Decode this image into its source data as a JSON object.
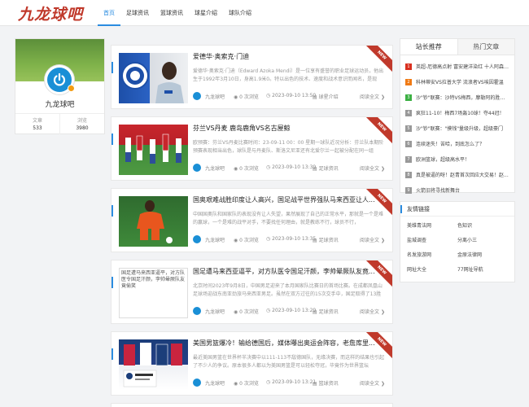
{
  "site": {
    "logo_text": "九龙球吧"
  },
  "nav": [
    "首页",
    "足球资讯",
    "篮球资讯",
    "球星介绍",
    "球队介绍"
  ],
  "profile": {
    "name": "九龙球吧",
    "articles_label": "文章",
    "articles_count": "533",
    "views_label": "浏览",
    "views_count": "3980"
  },
  "articles": [
    {
      "title": "爱德华·奥索克·门迪",
      "excerpt": "爱德华·奥索克·门迪（Edward Azoka Mendi）是一位享有盛誉的职业足球运动员，他出生于1992年3月10日，身高1.9米0。特以出色的技术、速度和战术意识而闻名，是现",
      "author": "九龙球吧",
      "views": "0 次浏览",
      "date": "2023-09-10 13:50",
      "category": "球星介绍",
      "more": "阅读全文",
      "ribbon": "NEW"
    },
    {
      "title": "芬兰VS丹麦 鹿岛鹿角VS名古屋鲸",
      "excerpt": "欧预赛：芬兰VS丹麦比赛时间：23-09-11 00：00 星期一球队近况分析：芬兰队本期阶预赛表现相当出色，球队是与丹麦队、斯洛文尼亚还有北爱尔兰一起被分配在同一组",
      "author": "九龙球吧",
      "views": "0 次浏览",
      "date": "2023-09-10 13:39",
      "category": "足球资讯",
      "more": "阅读全文",
      "ribbon": "NEW"
    },
    {
      "title": "国奥艰难战胜印度让人高兴，国足战平世界强队马来西亚让人...",
      "excerpt": "中国国奥队和国家队的表现没有让人失望，果然展现了自己的正常水平，那就是一个是难的赢球，一个是难的战平对手，不要找任何理由，就是教练不行，球员不行，",
      "author": "九龙球吧",
      "views": "0 次浏览",
      "date": "2023-09-10 13:35",
      "category": "足球资讯",
      "more": "阅读全文",
      "ribbon": "NEW"
    },
    {
      "title": "国足遭马来西亚逼平，对方队医令国足汗颜，李帅晕厥队友竟...",
      "excerpt": "北京时间2023年9月8日，中国男足迎来了本月国家队比赛日的首场比赛。在成都凤凰山足球场迎战东南亚劲旅马来西亚男足。虽然在双方过往的15次交手中，国足取得了13胜",
      "author": "九龙球吧",
      "views": "0 次浏览",
      "date": "2023-09-10 13:29",
      "category": "足球资讯",
      "more": "阅读全文",
      "ribbon": "NEW",
      "thumb_alt": "国足遭马来西亚逼平，对方队医令国足汗颜，李帅晕厥队友竟偷笑"
    },
    {
      "title": "美国男篮爆冷！输给德国后，媒体曝出奥运会阵容，老詹库里...",
      "excerpt": "最近美国男篮在世界杯半决赛中以111-113不敌德国队，无缘决赛，而这样的结果也引起了不少人的争议。原本很多人都以为美国男篮是可以轻松夺冠，毕竟作为世界篮坛",
      "author": "九龙球吧",
      "views": "0 次浏览",
      "date": "2023-09-10 13:21",
      "category": "篮球资讯",
      "more": "阅读全文",
      "ribbon": "NEW"
    }
  ],
  "sidebar": {
    "tabs": [
      "站长推荐",
      "热门文章"
    ],
    "rank": [
      "英超-厄德高点射 富安建洋染红 十人阿森纳1-0",
      "科林蒂安VS拉普大学 流浪者VS埃因霍温",
      "沙\"钞\"联赛：沙特VS梅西，摩勒阿的胜利！",
      "疯狂11-10！梅西7场轰10球！夺44冠！",
      "沙\"钞\"联赛：\"摸钱\"量级升级，超级豪门",
      "连续迷失！苦哈，到底怎么了？",
      "欧洲篮球，超级高水平！",
      "真是被逼的呀！赵青首次回应大交易！赵...",
      "火箭旧将寻找新舞台"
    ],
    "rank_colors": [
      "#d9301f",
      "#f07a14",
      "#3cb043",
      "#999999",
      "#999999",
      "#999999",
      "#999999",
      "#999999",
      "#999999"
    ],
    "links_title": "友情链接",
    "links": [
      "美维青法网",
      "色知识",
      "盐城调查",
      "分离小三",
      "名发旅游网",
      "金原法律网",
      "网址大全",
      "77网址导航"
    ]
  }
}
